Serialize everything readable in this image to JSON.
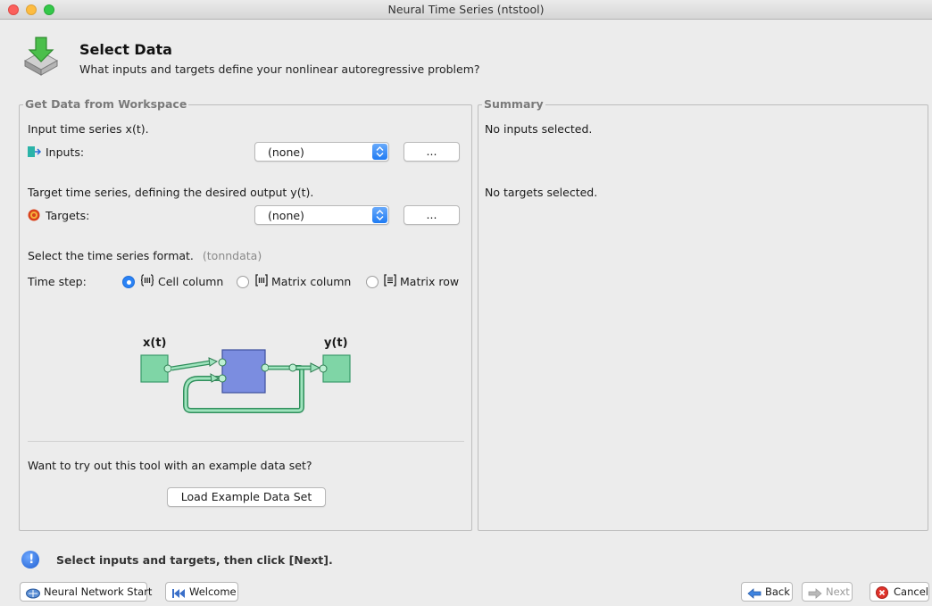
{
  "window": {
    "title": "Neural Time Series (ntstool)"
  },
  "header": {
    "title": "Select Data",
    "subtitle": "What inputs and targets define your nonlinear autoregressive problem?"
  },
  "workspace": {
    "title": "Get Data from Workspace",
    "input_desc": "Input time series x(t).",
    "inputs_label": "Inputs:",
    "inputs_value": "(none)",
    "inputs_browse": "...",
    "target_desc": "Target time series, defining the desired output y(t).",
    "targets_label": "Targets:",
    "targets_value": "(none)",
    "targets_browse": "...",
    "format_desc": "Select the time series format.",
    "format_hint": "(tonndata)",
    "timestep_label": "Time step:",
    "formats": [
      {
        "label": "Cell column",
        "selected": true
      },
      {
        "label": "Matrix column",
        "selected": false
      },
      {
        "label": "Matrix row",
        "selected": false
      }
    ],
    "diagram": {
      "input_label": "x(t)",
      "output_label": "y(t)"
    },
    "example_prompt": "Want to try out this tool with an example data set?",
    "load_button": "Load Example Data Set"
  },
  "summary": {
    "title": "Summary",
    "inputs_status": "No inputs selected.",
    "targets_status": "No targets selected."
  },
  "status": {
    "message": "Select inputs and targets, then click [Next]."
  },
  "footer": {
    "nn_start": "Neural Network Start",
    "welcome": "Welcome",
    "back": "Back",
    "next": "Next",
    "cancel": "Cancel"
  },
  "colors": {
    "accent": "#2a82f5",
    "block_fill": "#7b8de0",
    "io_fill": "#7fd5a6",
    "wire": "#3a9a6a"
  }
}
